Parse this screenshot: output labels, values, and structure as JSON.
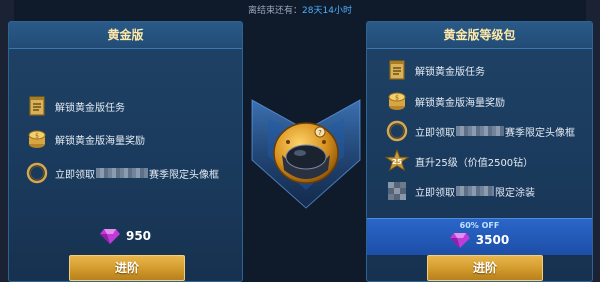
{
  "timer": {
    "label": "离结束还有：",
    "remaining": "28天14小时"
  },
  "gold_pass": {
    "title": "黄金版",
    "features": [
      {
        "icon": "task-scroll-icon",
        "label": "解锁黄金版任务"
      },
      {
        "icon": "coin-stack-icon",
        "label": "解锁黄金版海量奖励"
      },
      {
        "icon": "ring-frame-icon",
        "label_before": "立即领取",
        "label_after": "赛季限定头像框"
      }
    ],
    "price": "950",
    "button_label": "进阶"
  },
  "upgrade_pack": {
    "title": "黄金版等级包",
    "features": [
      {
        "icon": "task-scroll-icon",
        "label": "解锁黄金版任务"
      },
      {
        "icon": "coin-stack-icon",
        "label": "解锁黄金版海量奖励"
      },
      {
        "icon": "ring-frame-icon",
        "label_before": "立即领取",
        "label_after": "赛季限定头像框"
      },
      {
        "icon": "level-star-icon",
        "badge": "25",
        "label": "直升25级（价值2500钻）"
      },
      {
        "icon": "spray-paint-icon",
        "label_before": "立即领取",
        "label_after": "限定涂装"
      }
    ],
    "discount": "60% OFF",
    "price": "3500",
    "button_label": "进阶"
  },
  "colors": {
    "accent_gold": "#d29a2c",
    "title_text": "#ffe9a8",
    "timer_highlight": "#4fb0ff",
    "gem_purple": "#c03cd8"
  }
}
